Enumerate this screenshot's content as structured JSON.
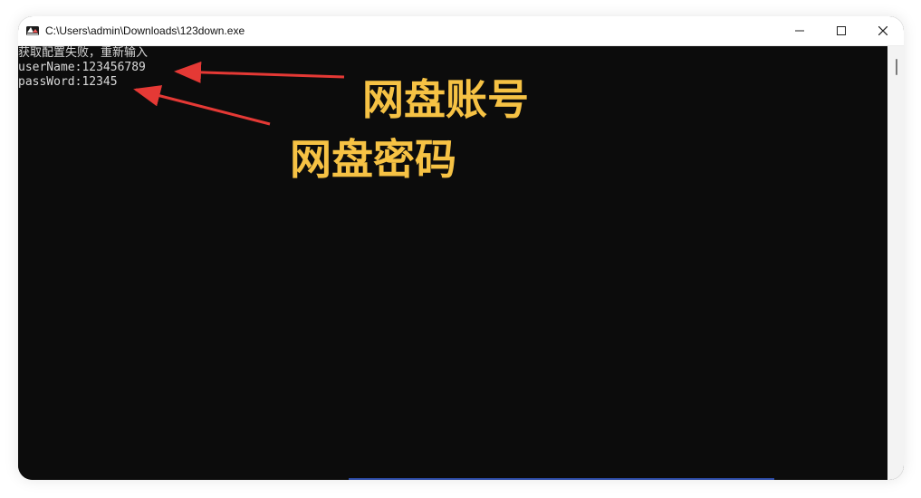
{
  "window": {
    "title": "C:\\Users\\admin\\Downloads\\123down.exe",
    "icon": "console-app-icon"
  },
  "console": {
    "lines": [
      "获取配置失败，重新输入",
      "userName:123456789",
      "passWord:12345"
    ]
  },
  "annotations": {
    "account": "网盘账号",
    "password": "网盘密码"
  },
  "colors": {
    "console_background": "#0c0c0c",
    "console_text": "#d9d9d9",
    "annotation_text": "#f6c244",
    "arrow": "#e53935",
    "titlebar": "#ffffff"
  },
  "controls": {
    "minimize": "minimize-icon",
    "maximize": "maximize-icon",
    "close": "close-icon"
  }
}
